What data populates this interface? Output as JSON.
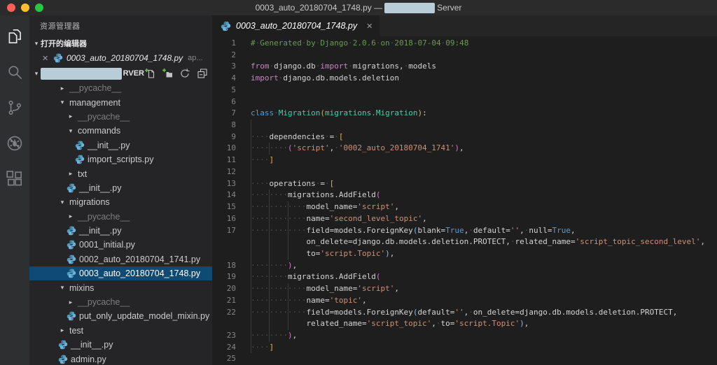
{
  "window": {
    "title_left": "0003_auto_20180704_1748.py —",
    "title_right": "Server",
    "redacted": true
  },
  "icons": {
    "close_glyph": "✕"
  },
  "colors": {
    "editor_bg": "#1e1e1e",
    "sidebar_bg": "#252528",
    "activitybar_bg": "#2d2f31",
    "titlebar_bg": "#2b2b2c",
    "selection_bg": "#0e4a73",
    "redaction": "#b9cdd9",
    "python_icon_blue": "#519aba",
    "traffic_lights": [
      "#ff5f57",
      "#febc2e",
      "#28c840"
    ],
    "token_comment": "#6a9955",
    "token_keyword": "#c586c0",
    "token_keyword2": "#569cd6",
    "token_type": "#4ec9b0",
    "token_string": "#ce9178",
    "bracket_gold": "#d9b44a",
    "bracket_orchid": "#da70d6",
    "bracket_blue": "#7cc0ee"
  },
  "activity_bar": {
    "items": [
      {
        "name": "explorer",
        "active": true
      },
      {
        "name": "search",
        "active": false
      },
      {
        "name": "source-control",
        "active": false
      },
      {
        "name": "debug",
        "active": false
      },
      {
        "name": "extensions",
        "active": false
      }
    ]
  },
  "sidebar": {
    "title": "资源管理器",
    "open_editors": {
      "label": "打开的编辑器",
      "items": [
        {
          "name": "0003_auto_20180704_1748.py",
          "suffix": "ap...",
          "icon": "python"
        }
      ]
    },
    "workspace": {
      "visible_suffix": "RVER",
      "redacted": true,
      "actions": [
        "new-file",
        "new-folder",
        "refresh",
        "collapse-all"
      ]
    },
    "tree": [
      {
        "depth": 0,
        "kind": "folder",
        "state": "collapsed",
        "name": "__pycache__",
        "dim": true
      },
      {
        "depth": 0,
        "kind": "folder",
        "state": "expanded",
        "name": "management"
      },
      {
        "depth": 1,
        "kind": "folder",
        "state": "collapsed",
        "name": "__pycache__",
        "dim": true
      },
      {
        "depth": 1,
        "kind": "folder",
        "state": "expanded",
        "name": "commands"
      },
      {
        "depth": 2,
        "kind": "file",
        "name": "__init__.py"
      },
      {
        "depth": 2,
        "kind": "file",
        "name": "import_scripts.py"
      },
      {
        "depth": 1,
        "kind": "folder",
        "state": "collapsed",
        "name": "txt"
      },
      {
        "depth": 1,
        "kind": "file",
        "name": "__init__.py"
      },
      {
        "depth": 0,
        "kind": "folder",
        "state": "expanded",
        "name": "migrations"
      },
      {
        "depth": 1,
        "kind": "folder",
        "state": "collapsed",
        "name": "__pycache__",
        "dim": true
      },
      {
        "depth": 1,
        "kind": "file",
        "name": "__init__.py"
      },
      {
        "depth": 1,
        "kind": "file",
        "name": "0001_initial.py"
      },
      {
        "depth": 1,
        "kind": "file",
        "name": "0002_auto_20180704_1741.py"
      },
      {
        "depth": 1,
        "kind": "file",
        "name": "0003_auto_20180704_1748.py",
        "selected": true
      },
      {
        "depth": 0,
        "kind": "folder",
        "state": "expanded",
        "name": "mixins"
      },
      {
        "depth": 1,
        "kind": "folder",
        "state": "collapsed",
        "name": "__pycache__",
        "dim": true
      },
      {
        "depth": 1,
        "kind": "file",
        "name": "put_only_update_model_mixin.py"
      },
      {
        "depth": 0,
        "kind": "folder",
        "state": "collapsed",
        "name": "test"
      },
      {
        "depth": 0,
        "kind": "file",
        "name": "__init__.py"
      },
      {
        "depth": 0,
        "kind": "file",
        "name": "admin.py"
      }
    ]
  },
  "editor": {
    "tab": {
      "name": "0003_auto_20180704_1748.py",
      "icon": "python"
    },
    "lines": [
      {
        "n": "1",
        "ind": 0,
        "dots": true,
        "toks": [
          [
            "# Generated by Django 2.0.6 on 2018-07-04 09:48",
            "com"
          ]
        ]
      },
      {
        "n": "2",
        "ind": 0,
        "dots": false,
        "toks": []
      },
      {
        "n": "3",
        "ind": 0,
        "dots": true,
        "toks": [
          [
            "from",
            "kw"
          ],
          [
            " django.db ",
            "def"
          ],
          [
            "import",
            "kw"
          ],
          [
            " migrations, models",
            "def"
          ]
        ]
      },
      {
        "n": "4",
        "ind": 0,
        "dots": true,
        "toks": [
          [
            "import",
            "kw"
          ],
          [
            " django.db.models.deletion",
            "def"
          ]
        ]
      },
      {
        "n": "5",
        "ind": 0,
        "dots": false,
        "toks": []
      },
      {
        "n": "6",
        "ind": 0,
        "dots": false,
        "toks": []
      },
      {
        "n": "7",
        "ind": 0,
        "dots": true,
        "toks": [
          [
            "class",
            "kw2"
          ],
          [
            " ",
            "def"
          ],
          [
            "Migration",
            "typ"
          ],
          [
            "(",
            "b1"
          ],
          [
            "migrations.Migration",
            "typ"
          ],
          [
            ")",
            "b1"
          ],
          [
            ":",
            "def"
          ]
        ]
      },
      {
        "n": "8",
        "ind": 4,
        "dots": false,
        "toks": []
      },
      {
        "n": "9",
        "ind": 4,
        "dots": true,
        "toks": [
          [
            "dependencies = ",
            "def"
          ],
          [
            "[",
            "b1"
          ]
        ]
      },
      {
        "n": "10",
        "ind": 8,
        "dots": true,
        "toks": [
          [
            "(",
            "b2"
          ],
          [
            "'script'",
            "str"
          ],
          [
            ", ",
            "def"
          ],
          [
            "'0002_auto_20180704_1741'",
            "str"
          ],
          [
            ")",
            "b2"
          ],
          [
            ",",
            "def"
          ]
        ]
      },
      {
        "n": "11",
        "ind": 4,
        "dots": true,
        "toks": [
          [
            "]",
            "b1"
          ]
        ]
      },
      {
        "n": "12",
        "ind": 4,
        "dots": false,
        "toks": []
      },
      {
        "n": "13",
        "ind": 4,
        "dots": true,
        "toks": [
          [
            "operations = ",
            "def"
          ],
          [
            "[",
            "b1"
          ]
        ]
      },
      {
        "n": "14",
        "ind": 8,
        "dots": true,
        "toks": [
          [
            "migrations.AddField",
            "def"
          ],
          [
            "(",
            "b2"
          ]
        ]
      },
      {
        "n": "15",
        "ind": 12,
        "dots": true,
        "toks": [
          [
            "model_name=",
            "def"
          ],
          [
            "'script'",
            "str"
          ],
          [
            ",",
            "def"
          ]
        ]
      },
      {
        "n": "16",
        "ind": 12,
        "dots": true,
        "toks": [
          [
            "name=",
            "def"
          ],
          [
            "'second_level_topic'",
            "str"
          ],
          [
            ",",
            "def"
          ]
        ]
      },
      {
        "n": "17",
        "ind": 12,
        "dots": true,
        "toks": [
          [
            "field=models.ForeignKey",
            "def"
          ],
          [
            "(",
            "b3"
          ],
          [
            "blank=",
            "def"
          ],
          [
            "True",
            "kw2"
          ],
          [
            ", default=",
            "def"
          ],
          [
            "''",
            "str"
          ],
          [
            ", null=",
            "def"
          ],
          [
            "True",
            "kw2"
          ],
          [
            ",",
            "def"
          ]
        ]
      },
      {
        "n": "",
        "ind": 12,
        "dots": false,
        "toks": [
          [
            "on_delete=django.db.models.deletion.PROTECT, related_name=",
            "def"
          ],
          [
            "'script_topic_second_level'",
            "str"
          ],
          [
            ",",
            "def"
          ]
        ]
      },
      {
        "n": "",
        "ind": 12,
        "dots": false,
        "toks": [
          [
            "to=",
            "def"
          ],
          [
            "'script.Topic'",
            "str"
          ],
          [
            ")",
            "b3"
          ],
          [
            ",",
            "def"
          ]
        ]
      },
      {
        "n": "18",
        "ind": 8,
        "dots": true,
        "toks": [
          [
            ")",
            "b2"
          ],
          [
            ",",
            "def"
          ]
        ]
      },
      {
        "n": "19",
        "ind": 8,
        "dots": true,
        "toks": [
          [
            "migrations.AddField",
            "def"
          ],
          [
            "(",
            "b2"
          ]
        ]
      },
      {
        "n": "20",
        "ind": 12,
        "dots": true,
        "toks": [
          [
            "model_name=",
            "def"
          ],
          [
            "'script'",
            "str"
          ],
          [
            ",",
            "def"
          ]
        ]
      },
      {
        "n": "21",
        "ind": 12,
        "dots": true,
        "toks": [
          [
            "name=",
            "def"
          ],
          [
            "'topic'",
            "str"
          ],
          [
            ",",
            "def"
          ]
        ]
      },
      {
        "n": "22",
        "ind": 12,
        "dots": true,
        "toks": [
          [
            "field=models.ForeignKey",
            "def"
          ],
          [
            "(",
            "b3"
          ],
          [
            "default=",
            "def"
          ],
          [
            "''",
            "str"
          ],
          [
            ", on_delete=django.db.models.deletion.PROTECT,",
            "def"
          ]
        ]
      },
      {
        "n": "",
        "ind": 12,
        "dots": false,
        "toks": [
          [
            "related_name=",
            "def"
          ],
          [
            "'script_topic'",
            "str"
          ],
          [
            ", to=",
            "def"
          ],
          [
            "'script.Topic'",
            "str"
          ],
          [
            ")",
            "b3"
          ],
          [
            ",",
            "def"
          ]
        ]
      },
      {
        "n": "23",
        "ind": 8,
        "dots": true,
        "toks": [
          [
            ")",
            "b2"
          ],
          [
            ",",
            "def"
          ]
        ]
      },
      {
        "n": "24",
        "ind": 4,
        "dots": true,
        "toks": [
          [
            "]",
            "b1"
          ]
        ]
      },
      {
        "n": "25",
        "ind": 0,
        "dots": false,
        "toks": []
      }
    ]
  }
}
